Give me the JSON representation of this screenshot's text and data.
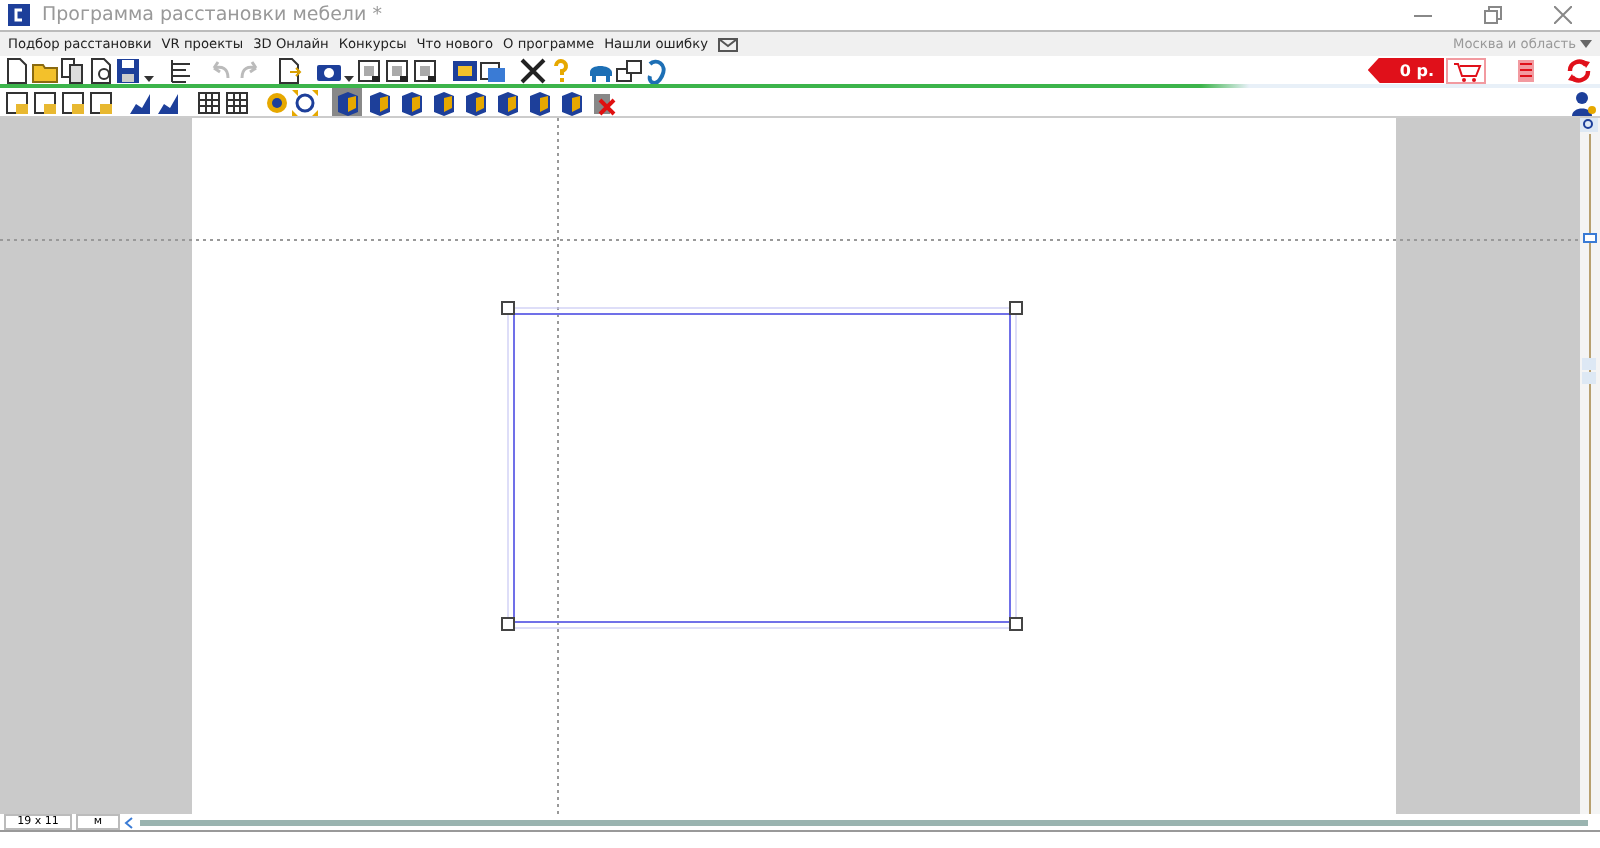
{
  "window": {
    "title": "Программа расстановки мебели *"
  },
  "menu": [
    "Подбор расстановки",
    "VR проекты",
    "3D Онлайн",
    "Конкурсы",
    "Что нового",
    "О программе",
    "Нашли ошибку"
  ],
  "region": "Москва и область",
  "price": "0 р.",
  "view_buttons": [
    {
      "selected": true
    },
    {
      "selected": false
    },
    {
      "selected": false
    },
    {
      "selected": false
    },
    {
      "selected": false
    },
    {
      "selected": false
    },
    {
      "selected": false
    },
    {
      "selected": false
    },
    {
      "selected": false
    }
  ],
  "status_bar": {
    "size": "19 x 11",
    "unit": "м"
  }
}
